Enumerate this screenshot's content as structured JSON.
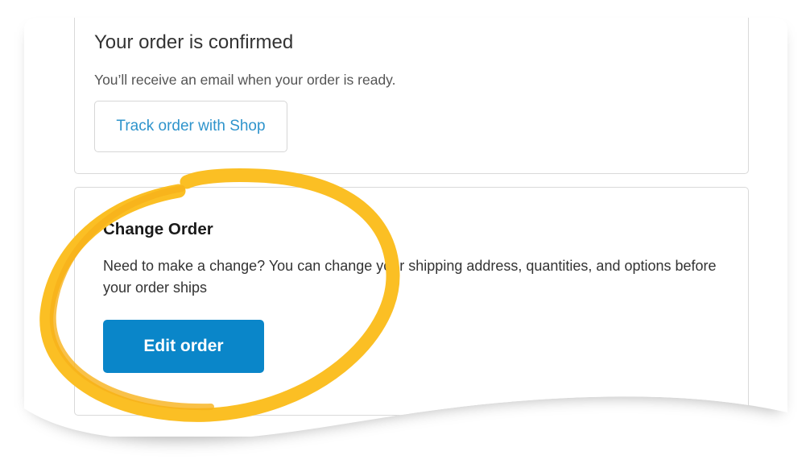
{
  "confirmation": {
    "title": "Your order is confirmed",
    "description": "You’ll receive an email when your order is ready.",
    "track_button_label": "Track order with Shop"
  },
  "change_order": {
    "title": "Change Order",
    "description": "Need to make a change? You can change your shipping address, quantities, and options before your order ships",
    "edit_button_label": "Edit order"
  },
  "colors": {
    "link_blue": "#2f94cc",
    "button_blue": "#0a86c9",
    "highlight_yellow": "#fbbf24",
    "border_gray": "#d9d9d9"
  },
  "annotation": {
    "type": "hand-drawn-circle",
    "target": "change_order"
  }
}
